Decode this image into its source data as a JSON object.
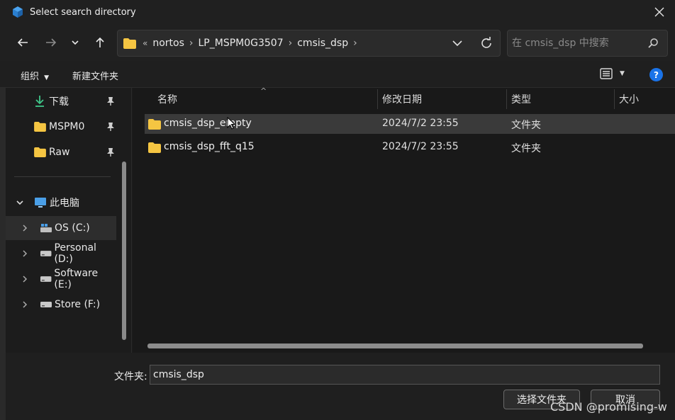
{
  "window": {
    "title": "Select search directory"
  },
  "address": {
    "overflow": "«",
    "crumbs": [
      "nortos",
      "LP_MSPM0G3507",
      "cmsis_dsp"
    ]
  },
  "search": {
    "placeholder": "在 cmsis_dsp 中搜索"
  },
  "toolbar": {
    "organize": "组织",
    "new_folder": "新建文件夹"
  },
  "sidebar": {
    "quick_access": [
      {
        "label": "下载",
        "icon": "download-icon"
      },
      {
        "label": "MSPM0",
        "icon": "folder-icon"
      },
      {
        "label": "Raw",
        "icon": "folder-icon"
      }
    ],
    "this_pc": "此电脑",
    "drives": [
      "OS (C:)",
      "Personal (D:)",
      "Software (E:)",
      "Store (F:)"
    ]
  },
  "columns": {
    "name": "名称",
    "modified": "修改日期",
    "type": "类型",
    "size": "大小"
  },
  "files": [
    {
      "name": "cmsis_dsp_empty",
      "modified": "2024/7/2 23:55",
      "type": "文件夹"
    },
    {
      "name": "cmsis_dsp_fft_q15",
      "modified": "2024/7/2 23:55",
      "type": "文件夹"
    }
  ],
  "bottom": {
    "folder_label": "文件夹:",
    "folder_value": "cmsis_dsp",
    "select_button": "选择文件夹",
    "cancel_button": "取消"
  },
  "watermark": "CSDN @promising-w",
  "colors": {
    "folder": "#f5c542",
    "accent": "#1a73e8",
    "drive": "#4a9fe8"
  }
}
